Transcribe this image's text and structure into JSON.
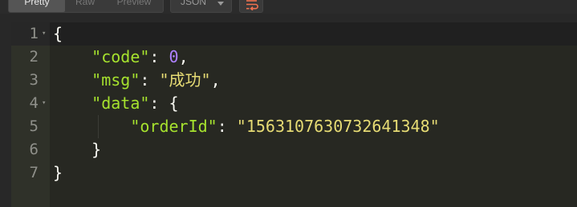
{
  "toolbar": {
    "tabs": [
      "Pretty",
      "Raw",
      "Preview"
    ],
    "active_tab": "Pretty",
    "format_value": "JSON",
    "icons": {
      "dropdown": "chevron-down-icon",
      "wrap": "wrap-text-icon"
    },
    "colors": {
      "toolbar_bg": "#2b2b2b",
      "button_bg": "#3a3a3a",
      "active_tab_bg": "#555555",
      "wrap_icon": "#f0714f"
    }
  },
  "editor": {
    "line_numbers": [
      "1",
      "2",
      "3",
      "4",
      "5",
      "6",
      "7"
    ],
    "foldable_lines": [
      "1",
      "4"
    ],
    "fold_icon": "fold-arrow-icon",
    "active_line": "1",
    "lines": [
      {
        "tokens": [
          {
            "kind": "p",
            "text": "{"
          }
        ]
      },
      {
        "tokens": [
          {
            "kind": "p",
            "text": "    "
          },
          {
            "kind": "k",
            "text": "\"code\""
          },
          {
            "kind": "p",
            "text": ": "
          },
          {
            "kind": "n",
            "text": "0"
          },
          {
            "kind": "p",
            "text": ","
          }
        ]
      },
      {
        "tokens": [
          {
            "kind": "p",
            "text": "    "
          },
          {
            "kind": "k",
            "text": "\"msg\""
          },
          {
            "kind": "p",
            "text": ": "
          },
          {
            "kind": "s",
            "text": "\"成功\""
          },
          {
            "kind": "p",
            "text": ","
          }
        ]
      },
      {
        "tokens": [
          {
            "kind": "p",
            "text": "    "
          },
          {
            "kind": "k",
            "text": "\"data\""
          },
          {
            "kind": "p",
            "text": ": {"
          }
        ]
      },
      {
        "tokens": [
          {
            "kind": "p",
            "text": "        "
          },
          {
            "kind": "k",
            "text": "\"orderId\""
          },
          {
            "kind": "p",
            "text": ": "
          },
          {
            "kind": "s",
            "text": "\"1563107630732641348\""
          }
        ]
      },
      {
        "tokens": [
          {
            "kind": "p",
            "text": "    }"
          }
        ]
      },
      {
        "tokens": [
          {
            "kind": "p",
            "text": "}"
          }
        ]
      }
    ],
    "colors": {
      "background": "#272822",
      "gutter": "#2f3129",
      "key": "#a6e22e",
      "number": "#ae81ff",
      "string": "#e6db74",
      "punctuation": "#f8f8f2",
      "line_number": "#8f908a"
    }
  }
}
